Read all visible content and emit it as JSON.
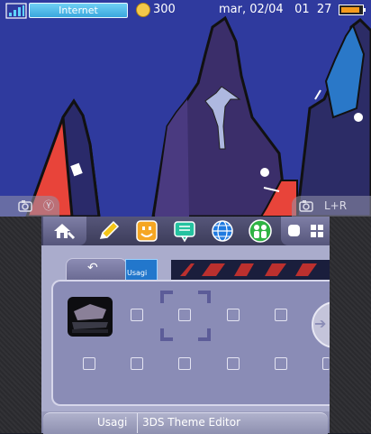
{
  "status_bar": {
    "connection_label": "Internet",
    "coin_count": "300",
    "datetime": "mar, 02/04   01  27",
    "signal_icon": "signal-bars-icon",
    "battery_icon": "battery-icon",
    "coin_icon": "play-coin-icon"
  },
  "shoulder": {
    "left_icon": "camera-y-icon",
    "left_label": "Ⓨ",
    "right_icon": "camera-l-r-icon",
    "right_label": "L+R"
  },
  "toolbar": {
    "home_icon": "home-settings-icon",
    "apps": [
      {
        "name": "pencil-icon",
        "color": "#f5c518"
      },
      {
        "name": "smiley-icon",
        "color": "#f5a623"
      },
      {
        "name": "speech-bubble-icon",
        "color": "#25c2a0"
      },
      {
        "name": "globe-icon",
        "color": "#1f7ae0"
      },
      {
        "name": "friends-icon",
        "color": "#2fb344"
      }
    ],
    "view_icons": [
      "circle-view-icon",
      "grid-view-icon"
    ]
  },
  "selected_app": {
    "mini_label": "Usagi"
  },
  "grid": {
    "rows": 2,
    "columns": 6
  },
  "bottom_tab": {
    "short_title": "Usagi",
    "title": "3DS Theme Editor"
  },
  "colors": {
    "accent": "#3aa7de",
    "panel": "#8a8cb6",
    "sky": "#2f3a9e"
  }
}
